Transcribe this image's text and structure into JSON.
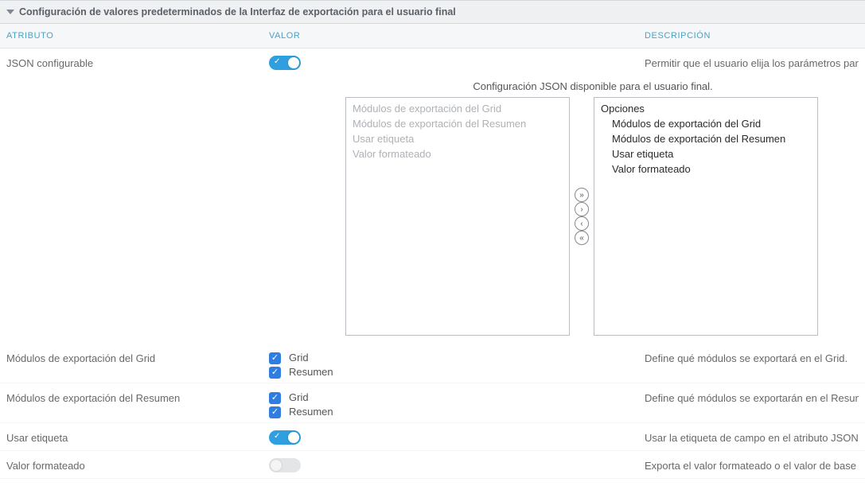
{
  "section_title": "Configuración de valores predeterminados de la Interfaz de exportación para el usuario final",
  "columns": {
    "attr": "ATRIBUTO",
    "val": "VALOR",
    "desc": "DESCRIPCIÓN"
  },
  "json_configurable": {
    "label": "JSON configurable",
    "desc": "Permitir que el usuario elija los parámetros para la c",
    "on": true
  },
  "json_block": {
    "subhead": "Configuración JSON disponible para el usuario final.",
    "left": [
      "Módulos de exportación del Grid",
      "Módulos de exportación del Resumen",
      "Usar etiqueta",
      "Valor formateado"
    ],
    "right_group": "Opciones",
    "right": [
      "Módulos de exportación del Grid",
      "Módulos de exportación del Resumen",
      "Usar etiqueta",
      "Valor formateado"
    ]
  },
  "grid_modules": {
    "label": "Módulos de exportación del Grid",
    "desc": "Define qué módulos se exportará en el Grid.",
    "opt1": "Grid",
    "opt2": "Resumen"
  },
  "summary_modules": {
    "label": "Módulos de exportación del Resumen",
    "desc": "Define qué módulos se exportarán en el Resumen.",
    "opt1": "Grid",
    "opt2": "Resumen"
  },
  "use_label": {
    "label": "Usar etiqueta",
    "desc": "Usar la etiqueta de campo en el atributo JSON",
    "on": true
  },
  "formatted_value": {
    "label": "Valor formateado",
    "desc": "Exporta el valor formateado o el valor de base de dat",
    "on": false
  }
}
